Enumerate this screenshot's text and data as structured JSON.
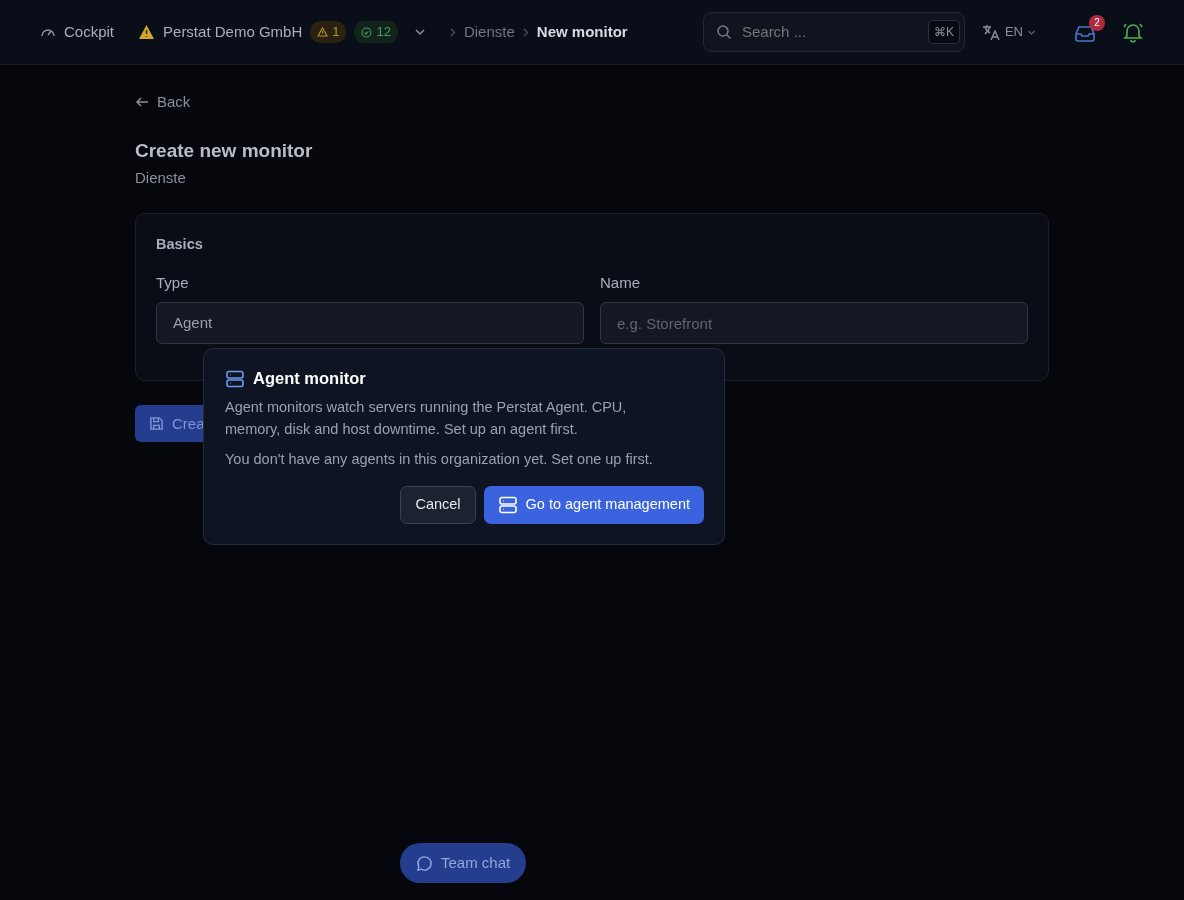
{
  "header": {
    "cockpit": "Cockpit",
    "org": "Perstat Demo GmbH",
    "warnings": "1",
    "ok": "12",
    "breadcrumbs": [
      {
        "label": "Dienste",
        "current": false
      },
      {
        "label": "New monitor",
        "current": true
      }
    ],
    "search": {
      "placeholder": "Search ...",
      "shortcut": "⌘K"
    },
    "language": "EN",
    "inbox_count": "2"
  },
  "back": "Back",
  "title": "Create new monitor",
  "subtitle": "Dienste",
  "form": {
    "section": "Basics",
    "fields": [
      {
        "kind": "select",
        "label": "Type",
        "value": "Agent"
      },
      {
        "kind": "text",
        "label": "Name",
        "placeholder": "e.g. Storefront"
      }
    ]
  },
  "submit": "Crea",
  "popover": {
    "title": "Agent monitor",
    "text": "Agent monitors watch servers running the Perstat Agent. CPU, memory, disk and host downtime. Set up an agent first.",
    "note": "You don't have any agents in this organization yet. Set one up first.",
    "cancel": "Cancel",
    "confirm": "Go to agent management"
  },
  "chat": "Team chat"
}
